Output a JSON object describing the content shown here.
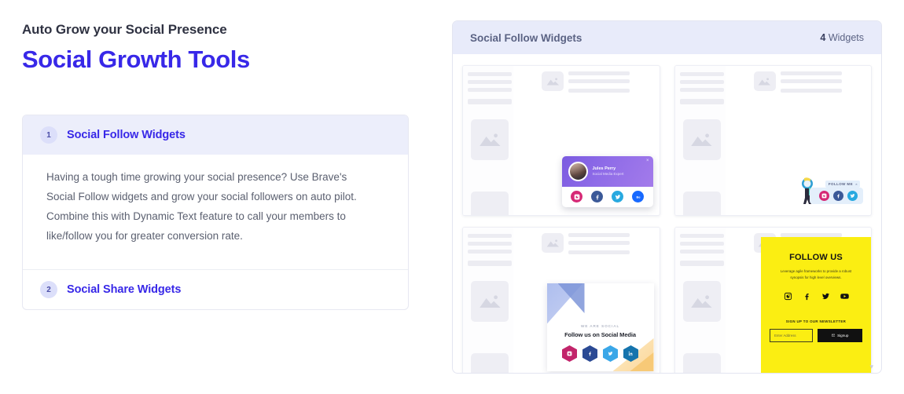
{
  "left": {
    "eyebrow": "Auto Grow your Social Presence",
    "title": "Social Growth Tools",
    "accordion": [
      {
        "num": "1",
        "title": "Social Follow Widgets",
        "body": "Having a tough time growing your social presence? Use Brave's Social Follow widgets and grow your social followers on auto pilot. Combine this with Dynamic Text feature to call your members to like/follow you for greater conversion rate."
      },
      {
        "num": "2",
        "title": "Social Share Widgets",
        "body": ""
      }
    ]
  },
  "panel": {
    "header_title": "Social Follow Widgets",
    "count_number": "4",
    "count_label": "Widgets"
  },
  "widgets": {
    "w1": {
      "name": "Jules Perry",
      "role": "Social Media Expert",
      "close": "×",
      "icons": [
        {
          "name": "instagram",
          "color": "#d62976"
        },
        {
          "name": "facebook",
          "color": "#3b5998"
        },
        {
          "name": "twitter",
          "color": "#28a9e0"
        },
        {
          "name": "behance",
          "color": "#1769ff"
        }
      ]
    },
    "w2": {
      "label": "FOLLOW ME",
      "close": "×",
      "icons": [
        {
          "name": "instagram",
          "color": "#d62976"
        },
        {
          "name": "facebook",
          "color": "#3b5998"
        },
        {
          "name": "twitter",
          "color": "#28a9e0"
        }
      ]
    },
    "w3": {
      "eyebrow": "WE ARE SOCIAL",
      "title": "Follow us on Social Media",
      "icons": [
        {
          "name": "instagram",
          "color": "#c2256b"
        },
        {
          "name": "facebook",
          "color": "#2b4a94"
        },
        {
          "name": "twitter",
          "color": "#3aa7e8"
        },
        {
          "name": "linkedin",
          "color": "#1574ad"
        }
      ]
    },
    "w4": {
      "title": "FOLLOW US",
      "text": "Leverage agile frameworks to provide a robust synopsis for high level overviews.",
      "subtitle": "SIGN UP TO OUR NEWSLETTER",
      "input_placeholder": "Enter Address",
      "button_label": "Signup",
      "bg_color": "#fbee12",
      "icons": [
        {
          "name": "instagram"
        },
        {
          "name": "facebook"
        },
        {
          "name": "twitter"
        },
        {
          "name": "youtube"
        }
      ]
    }
  },
  "colors": {
    "brand": "#3828e8",
    "panel_header_bg": "#e8ebfa",
    "accordion_active_bg": "#eceefb"
  }
}
